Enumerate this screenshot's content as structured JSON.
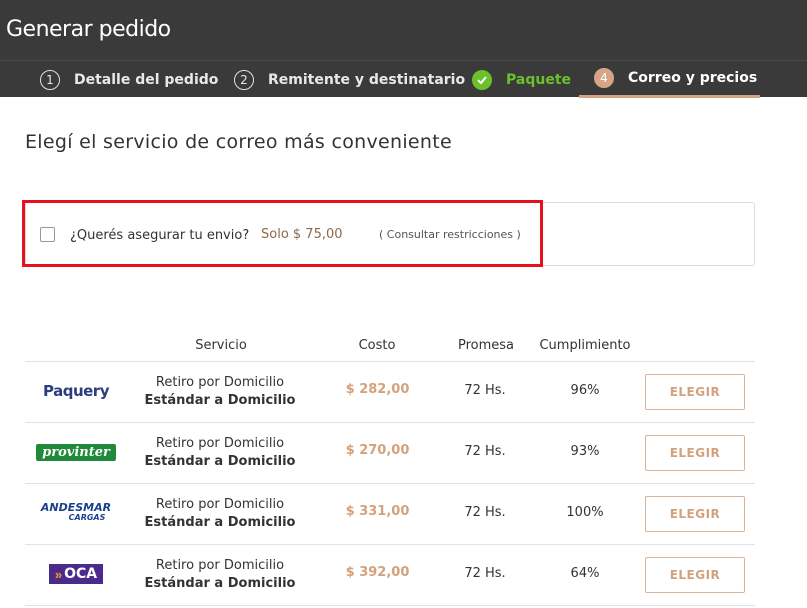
{
  "header": {
    "title": "Generar pedido"
  },
  "steps": [
    {
      "num": "1",
      "label": "Detalle del pedido",
      "state": "default"
    },
    {
      "num": "2",
      "label": "Remitente y destinatario",
      "state": "default"
    },
    {
      "num": "",
      "label": "Paquete",
      "state": "done",
      "icon": "check-icon"
    },
    {
      "num": "4",
      "label": "Correo y precios",
      "state": "active"
    }
  ],
  "main": {
    "title": "Elegí el servicio de correo más conveniente",
    "insurance": {
      "question": "¿Querés asegurar tu envio?",
      "price": "Solo $ 75,00",
      "link": "( Consultar restricciones )"
    },
    "table": {
      "headers": [
        "Servicio",
        "Costo",
        "Promesa",
        "Cumplimiento"
      ],
      "rows": [
        {
          "carrier": "Paquery",
          "service_line1": "Retiro por Domicilio",
          "service_line2": "Estándar a Domicilio",
          "cost": "$ 282,00",
          "promise": "72 Hs.",
          "fulfillment": "96%",
          "button": "ELEGIR"
        },
        {
          "carrier": "provinter",
          "service_line1": "Retiro por Domicilio",
          "service_line2": "Estándar a Domicilio",
          "cost": "$ 270,00",
          "promise": "72 Hs.",
          "fulfillment": "93%",
          "button": "ELEGIR"
        },
        {
          "carrier": "ANDESMAR",
          "carrier_sub": "CARGAS",
          "service_line1": "Retiro por Domicilio",
          "service_line2": "Estándar a Domicilio",
          "cost": "$ 331,00",
          "promise": "72 Hs.",
          "fulfillment": "100%",
          "button": "ELEGIR"
        },
        {
          "carrier": "OCA",
          "service_line1": "Retiro por Domicilio",
          "service_line2": "Estándar a Domicilio",
          "cost": "$ 392,00",
          "promise": "72 Hs.",
          "fulfillment": "64%",
          "button": "ELEGIR"
        }
      ]
    }
  },
  "colors": {
    "header_bg": "#3a3a3a",
    "accent": "#d7a585",
    "done_green": "#6cc02c",
    "highlight_red": "#e8101a"
  }
}
